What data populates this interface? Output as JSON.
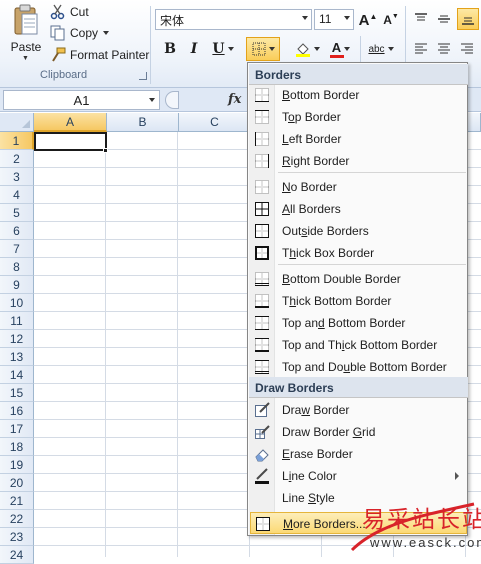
{
  "clipboard": {
    "paste_label": "Paste",
    "cut_label": "Cut",
    "copy_label": "Copy",
    "format_painter_label": "Format Painter",
    "group_label": "Clipboard"
  },
  "font": {
    "name": "宋体",
    "size": "11",
    "bold": "B",
    "italic": "I",
    "underline": "U",
    "grow_label": "A",
    "shrink_label": "A",
    "font_color_label": "A",
    "orientation_label": "abc"
  },
  "formula_bar": {
    "name_box": "A1",
    "fx_label": "fx"
  },
  "grid": {
    "columns": [
      "A",
      "B",
      "C"
    ],
    "rows": [
      "1",
      "2",
      "3",
      "4",
      "5",
      "6",
      "7",
      "8",
      "9",
      "10",
      "11",
      "12",
      "13",
      "14",
      "15",
      "16",
      "17",
      "18",
      "19",
      "20",
      "21",
      "22",
      "23",
      "24"
    ],
    "active_column": "A",
    "active_row": "1"
  },
  "menu": {
    "header_borders": "Borders",
    "header_draw": "Draw Borders",
    "items": [
      {
        "label": "Bottom Border",
        "icon": "bottom-border-icon"
      },
      {
        "label": "Top Border",
        "icon": "top-border-icon"
      },
      {
        "label": "Left Border",
        "icon": "left-border-icon"
      },
      {
        "label": "Right Border",
        "icon": "right-border-icon"
      },
      {
        "label": "No Border",
        "icon": "no-border-icon"
      },
      {
        "label": "All Borders",
        "icon": "all-borders-icon"
      },
      {
        "label": "Outside Borders",
        "icon": "outside-borders-icon"
      },
      {
        "label": "Thick Box Border",
        "icon": "thick-box-border-icon"
      },
      {
        "label": "Bottom Double Border",
        "icon": "bottom-double-border-icon"
      },
      {
        "label": "Thick Bottom Border",
        "icon": "thick-bottom-border-icon"
      },
      {
        "label": "Top and Bottom Border",
        "icon": "top-bottom-border-icon"
      },
      {
        "label": "Top and Thick Bottom Border",
        "icon": "top-thick-bottom-border-icon"
      },
      {
        "label": "Top and Double Bottom Border",
        "icon": "top-double-bottom-border-icon"
      },
      {
        "label": "Draw Border",
        "icon": "draw-border-icon"
      },
      {
        "label": "Draw Border Grid",
        "icon": "draw-border-grid-icon"
      },
      {
        "label": "Erase Border",
        "icon": "erase-border-icon"
      },
      {
        "label": "Line Color",
        "icon": "line-color-icon"
      },
      {
        "label": "Line Style",
        "icon": ""
      },
      {
        "label": "More Borders...",
        "icon": "more-borders-icon"
      }
    ]
  },
  "watermark": {
    "chinese": "易采站长站",
    "url": "www.easck.com"
  },
  "colors": {
    "accent_highlight": "#f9cd59",
    "header_blue": "#dfe8f5",
    "font_color_bar": "#e0201b",
    "fill_color_bar": "#ffff00"
  }
}
